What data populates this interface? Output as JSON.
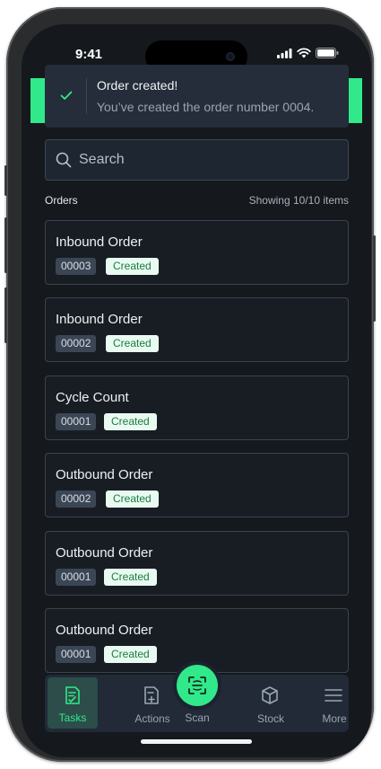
{
  "status_bar": {
    "time": "9:41"
  },
  "toast": {
    "title": "Order created!",
    "message": "You’ve created the order number 0004."
  },
  "search": {
    "placeholder": "Search"
  },
  "orders": {
    "label": "Orders",
    "count": "Showing 10/10 items",
    "items": [
      {
        "title": "Inbound Order",
        "number": "00003",
        "status": "Created"
      },
      {
        "title": "Inbound Order",
        "number": "00002",
        "status": "Created"
      },
      {
        "title": "Cycle Count",
        "number": "00001",
        "status": "Created"
      },
      {
        "title": "Outbound Order",
        "number": "00002",
        "status": "Created"
      },
      {
        "title": "Outbound Order",
        "number": "00001",
        "status": "Created"
      },
      {
        "title": "Outbound Order",
        "number": "00001",
        "status": "Created"
      }
    ]
  },
  "nav": {
    "tasks": "Tasks",
    "actions": "Actions",
    "scan": "Scan",
    "stock": "Stock",
    "more": "More"
  },
  "colors": {
    "accent": "#31e98a",
    "background": "#15181c",
    "status_badge_bg": "#e9fbf0",
    "status_badge_text": "#1c7a44"
  }
}
